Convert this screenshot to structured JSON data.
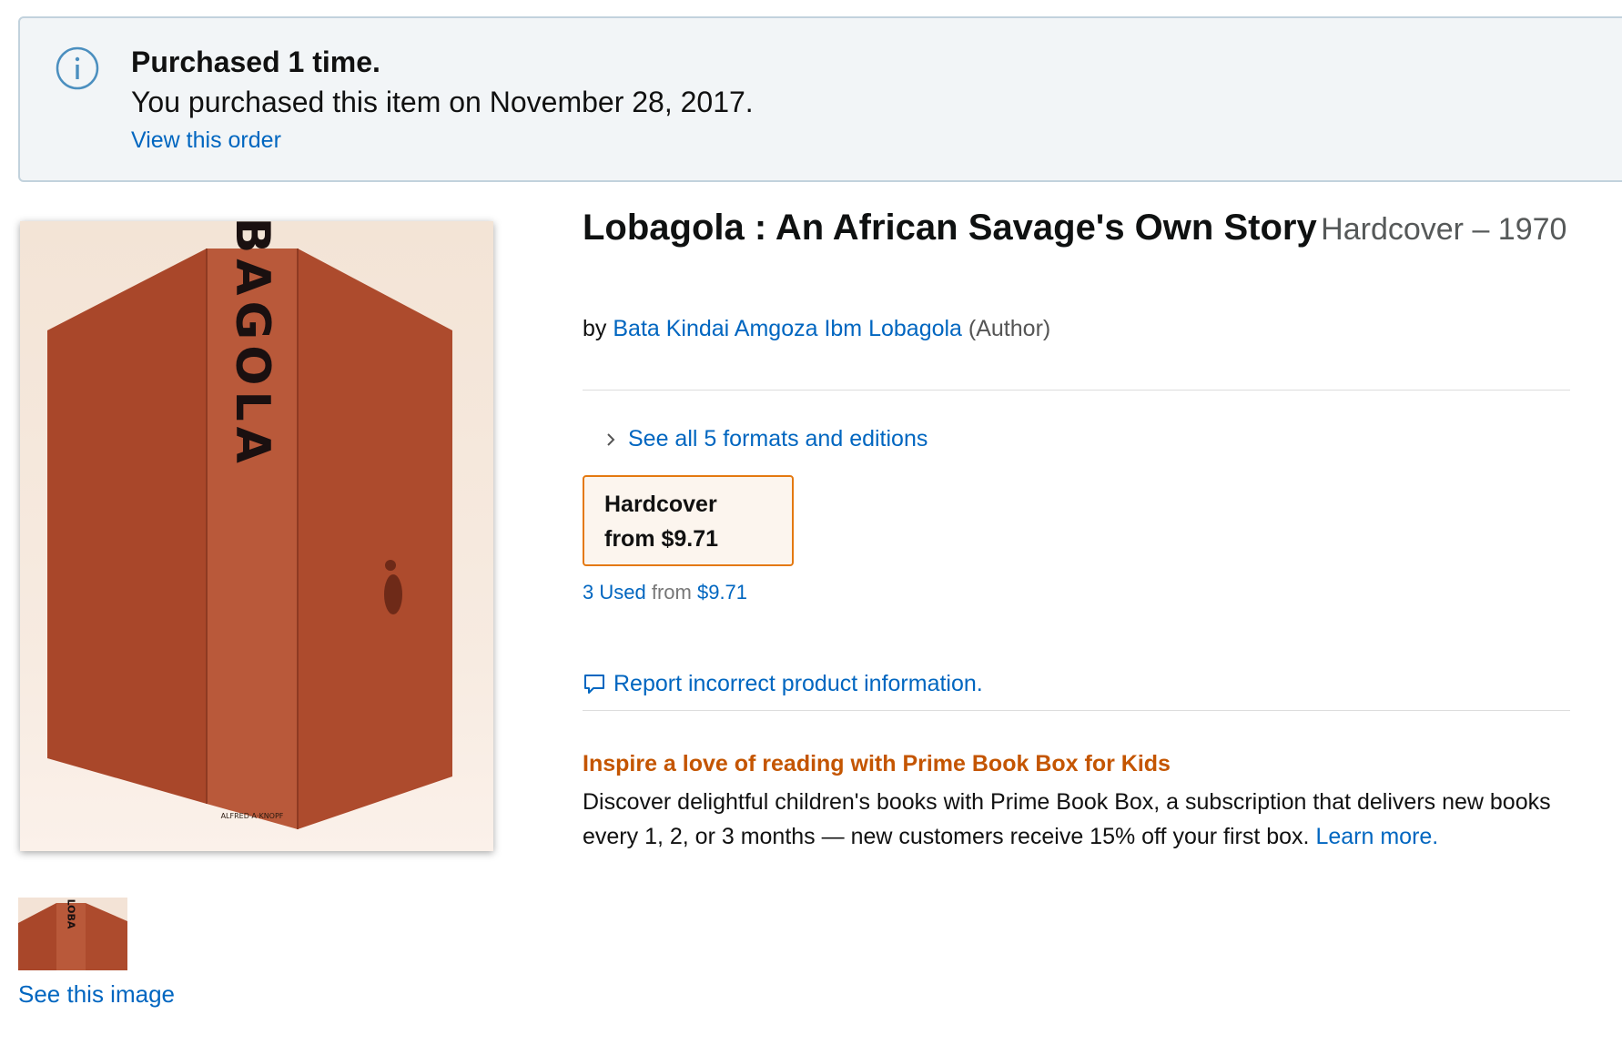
{
  "notice": {
    "title": "Purchased 1 time.",
    "text": "You purchased this item on November 28, 2017.",
    "link": "View this order",
    "icon": "info-icon"
  },
  "product": {
    "title": "Lobagola : An African Savage's Own Story",
    "binding": "Hardcover – 1970",
    "by_prefix": "by",
    "author": "Bata Kindai Amgoza Ibm Lobagola",
    "author_role": "(Author)",
    "book_spine_text": "LOBAGOLA",
    "publisher_mark": "ALFRED·A·KNOPF",
    "thumb_spine_text": "LOBA"
  },
  "images": {
    "see_image": "See this image"
  },
  "formats": {
    "see_all": "See all 5 formats and editions",
    "selected_name": "Hardcover",
    "selected_price": "from $9.71",
    "used_count": "3 Used",
    "used_from": "from",
    "used_price": "$9.71"
  },
  "report": {
    "label": "Report incorrect product information."
  },
  "promo": {
    "title": "Inspire a love of reading with Prime Book Box for Kids",
    "text": "Discover delightful children's books with Prime Book Box, a subscription that delivers new books every 1, 2, or 3 months — new customers receive 15% off your first box.",
    "link": "Learn more."
  },
  "colors": {
    "link": "#0066c0",
    "accent_orange": "#e47911",
    "promo_orange": "#c45500",
    "book_red": "#a84a2c"
  }
}
